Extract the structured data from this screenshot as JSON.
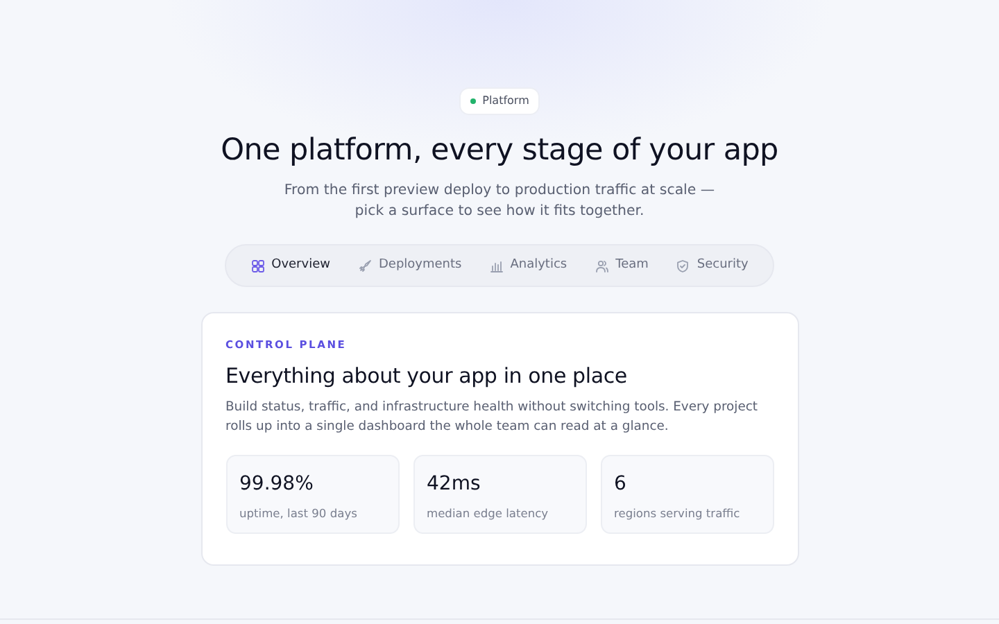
{
  "badge": {
    "label": "Platform"
  },
  "title": "One platform, every stage of your app",
  "subtitle": "From the first preview deploy to production traffic at scale — pick a surface to see how it fits together.",
  "tabs": [
    {
      "label": "Overview",
      "kind": "grid",
      "selected": true
    },
    {
      "label": "Deployments",
      "kind": "rocket",
      "selected": false
    },
    {
      "label": "Analytics",
      "kind": "chart",
      "selected": false
    },
    {
      "label": "Team",
      "kind": "people",
      "selected": false
    },
    {
      "label": "Security",
      "kind": "shield",
      "selected": false
    }
  ],
  "panel": {
    "eyebrow": "CONTROL PLANE",
    "heading": "Everything about your app in one place",
    "body": "Build status, traffic, and infrastructure health without switching tools. Every project rolls up into a single dashboard the whole team can read at a glance.",
    "stats": [
      {
        "value": "99.98%",
        "label": "uptime, last 90 days"
      },
      {
        "value": "42ms",
        "label": "median edge latency"
      },
      {
        "value": "6",
        "label": "regions serving traffic"
      }
    ]
  }
}
